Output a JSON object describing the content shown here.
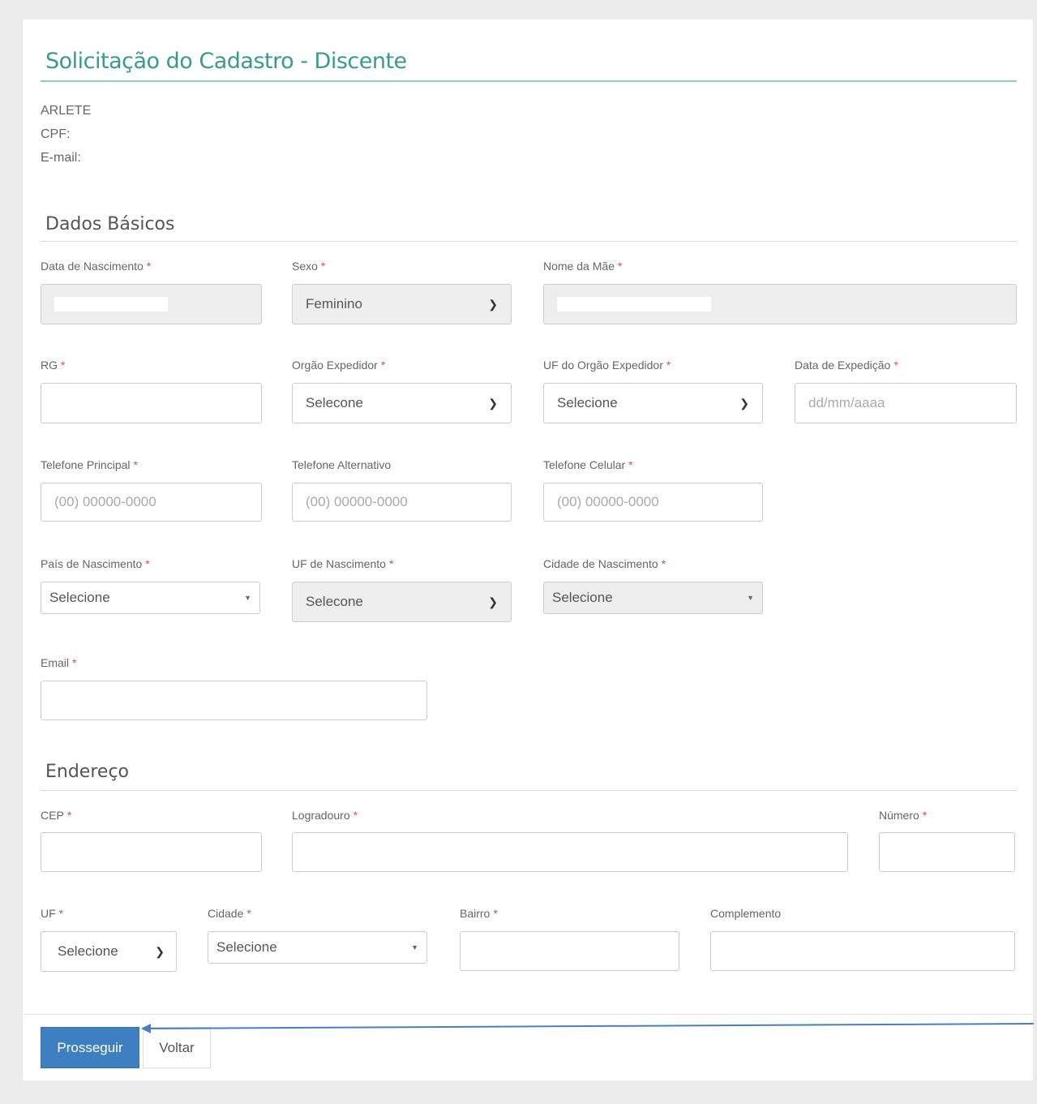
{
  "page": {
    "title": "Solicitação do Cadastro - Discente",
    "user": {
      "name": "ARLETE",
      "cpf_label": "CPF:",
      "email_label": "E-mail:"
    }
  },
  "sections": {
    "basic": "Dados Básicos",
    "address": "Endereço"
  },
  "fields": {
    "birth_date": {
      "label": "Data de Nascimento"
    },
    "sex": {
      "label": "Sexo",
      "value": "Feminino"
    },
    "mother_name": {
      "label": "Nome da Mãe"
    },
    "rg": {
      "label": "RG"
    },
    "issuer": {
      "label": "Orgão Expedidor",
      "value": "Selecone"
    },
    "issuer_uf": {
      "label": "UF do Orgão Expedidor",
      "value": "Selecione"
    },
    "issue_date": {
      "label": "Data de Expedição",
      "placeholder": "dd/mm/aaaa"
    },
    "phone_main": {
      "label": "Telefone Principal",
      "placeholder": "(00) 00000-0000"
    },
    "phone_alt": {
      "label": "Telefone Alternativo",
      "placeholder": "(00) 00000-0000"
    },
    "phone_cell": {
      "label": "Telefone Celular",
      "placeholder": "(00) 00000-0000"
    },
    "birth_country": {
      "label": "País de Nascimento",
      "value": "Selecione"
    },
    "birth_uf": {
      "label": "UF de Nascimento",
      "value": "Selecone"
    },
    "birth_city": {
      "label": "Cidade de Nascimento",
      "value": "Selecione"
    },
    "email": {
      "label": "Email"
    },
    "cep": {
      "label": "CEP"
    },
    "street": {
      "label": "Logradouro"
    },
    "number": {
      "label": "Número"
    },
    "uf": {
      "label": "UF",
      "value": "Selecione"
    },
    "city": {
      "label": "Cidade",
      "value": "Selecione"
    },
    "district": {
      "label": "Bairro"
    },
    "complement": {
      "label": "Complemento"
    }
  },
  "required_mark": "*",
  "buttons": {
    "continue": "Prosseguir",
    "back": "Voltar"
  },
  "colors": {
    "accent": "#3a9a8c",
    "primary": "#3d7fc1",
    "required": "#d9534f",
    "annotation_arrow": "#4a7fbf"
  }
}
